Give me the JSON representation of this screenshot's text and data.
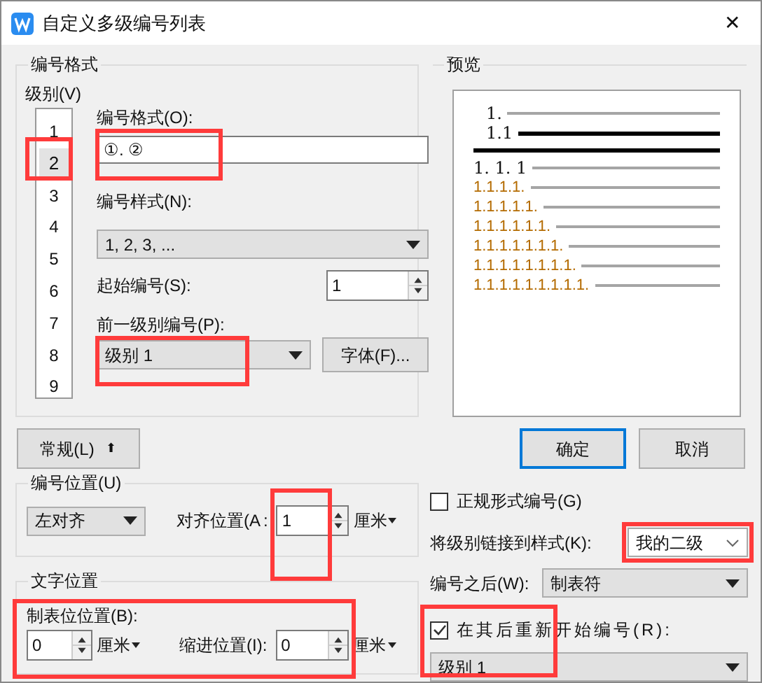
{
  "window": {
    "title": "自定义多级编号列表",
    "close": "✕"
  },
  "format_group": {
    "title": "编号格式",
    "level_label": "级别(V)",
    "levels": [
      {
        "label": "1",
        "selected": false,
        "highlighted": false
      },
      {
        "label": "2",
        "selected": true,
        "highlighted": true
      },
      {
        "label": "3",
        "selected": false,
        "highlighted": false
      },
      {
        "label": "4",
        "selected": false,
        "highlighted": false
      },
      {
        "label": "5",
        "selected": false,
        "highlighted": false
      },
      {
        "label": "6",
        "selected": false,
        "highlighted": false
      },
      {
        "label": "7",
        "selected": false,
        "highlighted": false
      },
      {
        "label": "8",
        "selected": false,
        "highlighted": false
      },
      {
        "label": "9",
        "selected": false,
        "highlighted": false
      }
    ],
    "format_label": "编号格式(O):",
    "format_value": "①. ②",
    "format_highlighted": true,
    "style_label": "编号样式(N):",
    "style_value": "1, 2, 3, ...",
    "start_label": "起始编号(S):",
    "start_value": "1",
    "previous_label": "前一级别编号(P):",
    "previous_value": "级别 1",
    "previous_highlighted": true,
    "font_button": "字体(F)..."
  },
  "preview": {
    "title": "预览",
    "lines": [
      {
        "text": "1.",
        "kind": "before"
      },
      {
        "text": "1.1",
        "kind": "current"
      },
      {
        "kind": "divider"
      },
      {
        "text": "1. 1. 1",
        "kind": "next"
      },
      {
        "text": "1.1.1.1.",
        "kind": "after"
      },
      {
        "text": "1.1.1.1.1.",
        "kind": "after"
      },
      {
        "text": "1.1.1.1.1.1.",
        "kind": "after"
      },
      {
        "text": "1.1.1.1.1.1.1.",
        "kind": "after"
      },
      {
        "text": "1.1.1.1.1.1.1.1.",
        "kind": "after"
      },
      {
        "text": "1.1.1.1.1.1.1.1.1.",
        "kind": "after"
      }
    ]
  },
  "general_button": "常规(L)",
  "general_arrow": "⬆",
  "ok_button": "确定",
  "cancel_button": "取消",
  "position_group": {
    "title": "编号位置(U)",
    "align_value": "左对齐",
    "align_at_label": "对齐位置(A",
    "align_at_colon": ":",
    "align_at_value": "1",
    "align_at_highlighted": true,
    "align_at_unit": "厘米"
  },
  "text_group": {
    "title": "文字位置",
    "highlighted": true,
    "tab_label": "制表位位置(B):",
    "tab_value": "0",
    "tab_unit": "厘米",
    "indent_label": "缩进位置(I):",
    "indent_value": "0",
    "indent_unit": "厘米"
  },
  "legal_numbering": {
    "label": "正规形式编号(G)",
    "checked": false
  },
  "link_style": {
    "label": "将级别链接到样式(K):",
    "value": "我的二级",
    "highlighted": true
  },
  "after_number": {
    "label": "编号之后(W):",
    "value": "制表符"
  },
  "restart": {
    "label": "在其后重新开始编号(R):",
    "checked": true,
    "value": "级别 1",
    "highlighted": true
  }
}
